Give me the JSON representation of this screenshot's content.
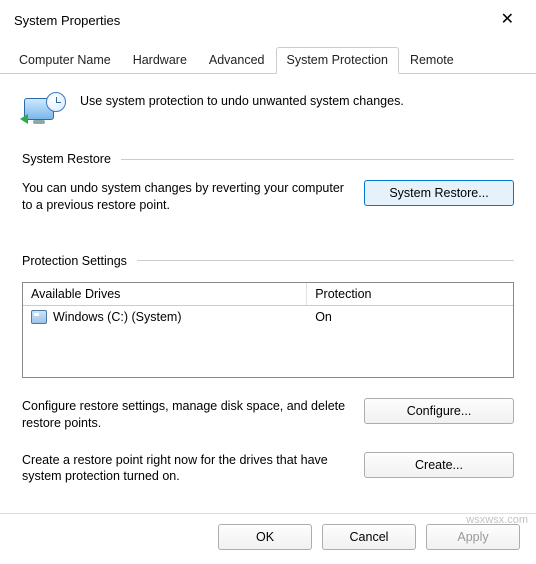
{
  "window": {
    "title": "System Properties"
  },
  "tabs": [
    {
      "label": "Computer Name",
      "active": false
    },
    {
      "label": "Hardware",
      "active": false
    },
    {
      "label": "Advanced",
      "active": false
    },
    {
      "label": "System Protection",
      "active": true
    },
    {
      "label": "Remote",
      "active": false
    }
  ],
  "intro": {
    "text": "Use system protection to undo unwanted system changes."
  },
  "section_restore": {
    "label": "System Restore",
    "description": "You can undo system changes by reverting your computer to a previous restore point.",
    "button": "System Restore..."
  },
  "section_settings": {
    "label": "Protection Settings",
    "columns": {
      "drives": "Available Drives",
      "protection": "Protection"
    },
    "rows": [
      {
        "drive": "Windows (C:) (System)",
        "protection": "On"
      }
    ],
    "configure_text": "Configure restore settings, manage disk space, and delete restore points.",
    "configure_button": "Configure...",
    "create_text": "Create a restore point right now for the drives that have system protection turned on.",
    "create_button": "Create..."
  },
  "footer": {
    "ok": "OK",
    "cancel": "Cancel",
    "apply": "Apply"
  },
  "watermark": "wsxwsx.com"
}
